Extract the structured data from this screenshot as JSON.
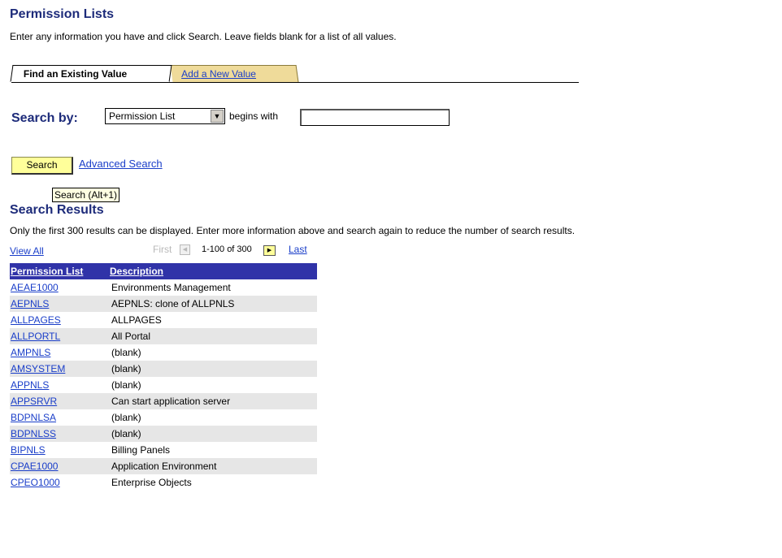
{
  "page": {
    "title": "Permission Lists",
    "instructions": "Enter any information you have and click Search. Leave fields blank for a list of all values."
  },
  "tabs": [
    {
      "label": "Find an Existing Value",
      "active": true
    },
    {
      "label": "Add a New Value",
      "active": false
    }
  ],
  "search": {
    "label": "Search by:",
    "field_selected": "Permission List",
    "operator": "begins with",
    "value": "",
    "button_label": "Search",
    "advanced_label": "Advanced Search",
    "tooltip": "Search (Alt+1)"
  },
  "results": {
    "title": "Search Results",
    "note": "Only the first 300 results can be displayed. Enter more information above and search again to reduce the number of search results.",
    "view_all": "View All",
    "nav": {
      "first": "First",
      "range": "1-100 of 300",
      "last": "Last"
    },
    "columns": [
      "Permission List",
      "Description"
    ],
    "rows": [
      {
        "code": "AEAE1000",
        "desc": "Environments Management"
      },
      {
        "code": "AEPNLS",
        "desc": "AEPNLS: clone of ALLPNLS"
      },
      {
        "code": "ALLPAGES",
        "desc": "ALLPAGES"
      },
      {
        "code": "ALLPORTL",
        "desc": "All Portal"
      },
      {
        "code": "AMPNLS",
        "desc": "(blank)"
      },
      {
        "code": "AMSYSTEM",
        "desc": "(blank)"
      },
      {
        "code": "APPNLS",
        "desc": "(blank)"
      },
      {
        "code": "APPSRVR",
        "desc": "Can start application server"
      },
      {
        "code": "BDPNLSA",
        "desc": "(blank)"
      },
      {
        "code": "BDPNLSS",
        "desc": "(blank)"
      },
      {
        "code": "BIPNLS",
        "desc": "Billing Panels"
      },
      {
        "code": "CPAE1000",
        "desc": "Application Environment"
      },
      {
        "code": "CPEO1000",
        "desc": "Enterprise Objects"
      }
    ]
  },
  "colors": {
    "title": "#1d2b7a",
    "link": "#1a3ec9",
    "header_bg": "#3033a8",
    "button_bg": "#ffff9a",
    "tab_inactive_bg": "#efdb9a",
    "row_alt_bg": "#e6e6e6"
  },
  "icons": {
    "dropdown": "chevron-down-icon",
    "prev": "arrow-left-icon",
    "next": "arrow-right-icon"
  }
}
